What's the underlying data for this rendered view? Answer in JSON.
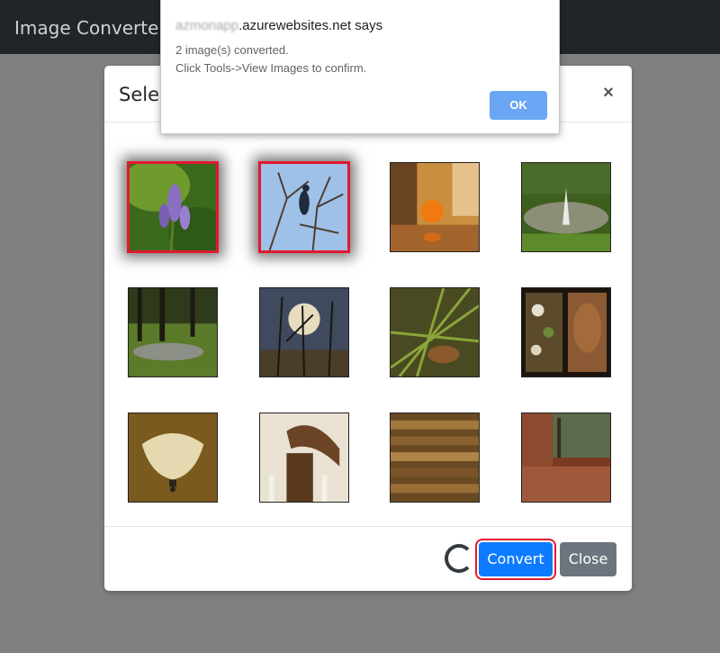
{
  "navbar": {
    "brand": "Image Converter"
  },
  "modal": {
    "title": "Select",
    "close_symbol": "×",
    "images": [
      {
        "name": "lavender-flowers",
        "selected": true
      },
      {
        "name": "bird-on-branch",
        "selected": true
      },
      {
        "name": "orange-on-table",
        "selected": false
      },
      {
        "name": "park-fountain",
        "selected": false
      },
      {
        "name": "forest-pond",
        "selected": false
      },
      {
        "name": "bare-trees-sunlight",
        "selected": false
      },
      {
        "name": "grass-leaves",
        "selected": false
      },
      {
        "name": "roasted-dish",
        "selected": false
      },
      {
        "name": "pendant-lamp",
        "selected": false
      },
      {
        "name": "stair-newel-post",
        "selected": false
      },
      {
        "name": "stacked-wood",
        "selected": false
      },
      {
        "name": "brick-patio",
        "selected": false
      }
    ],
    "buttons": {
      "convert": "Convert",
      "close": "Close"
    }
  },
  "alert": {
    "host_blurred": "azmonapp",
    "host_domain": ".azurewebsites.net says",
    "line1": "2 image(s) converted.",
    "line2": "Click Tools->View Images to confirm.",
    "ok": "OK"
  },
  "colors": {
    "navbar": "#212529",
    "primary": "#0d7bff",
    "secondary": "#6c757d",
    "highlight": "#e2192f",
    "ok_button": "#6aa6f4"
  }
}
